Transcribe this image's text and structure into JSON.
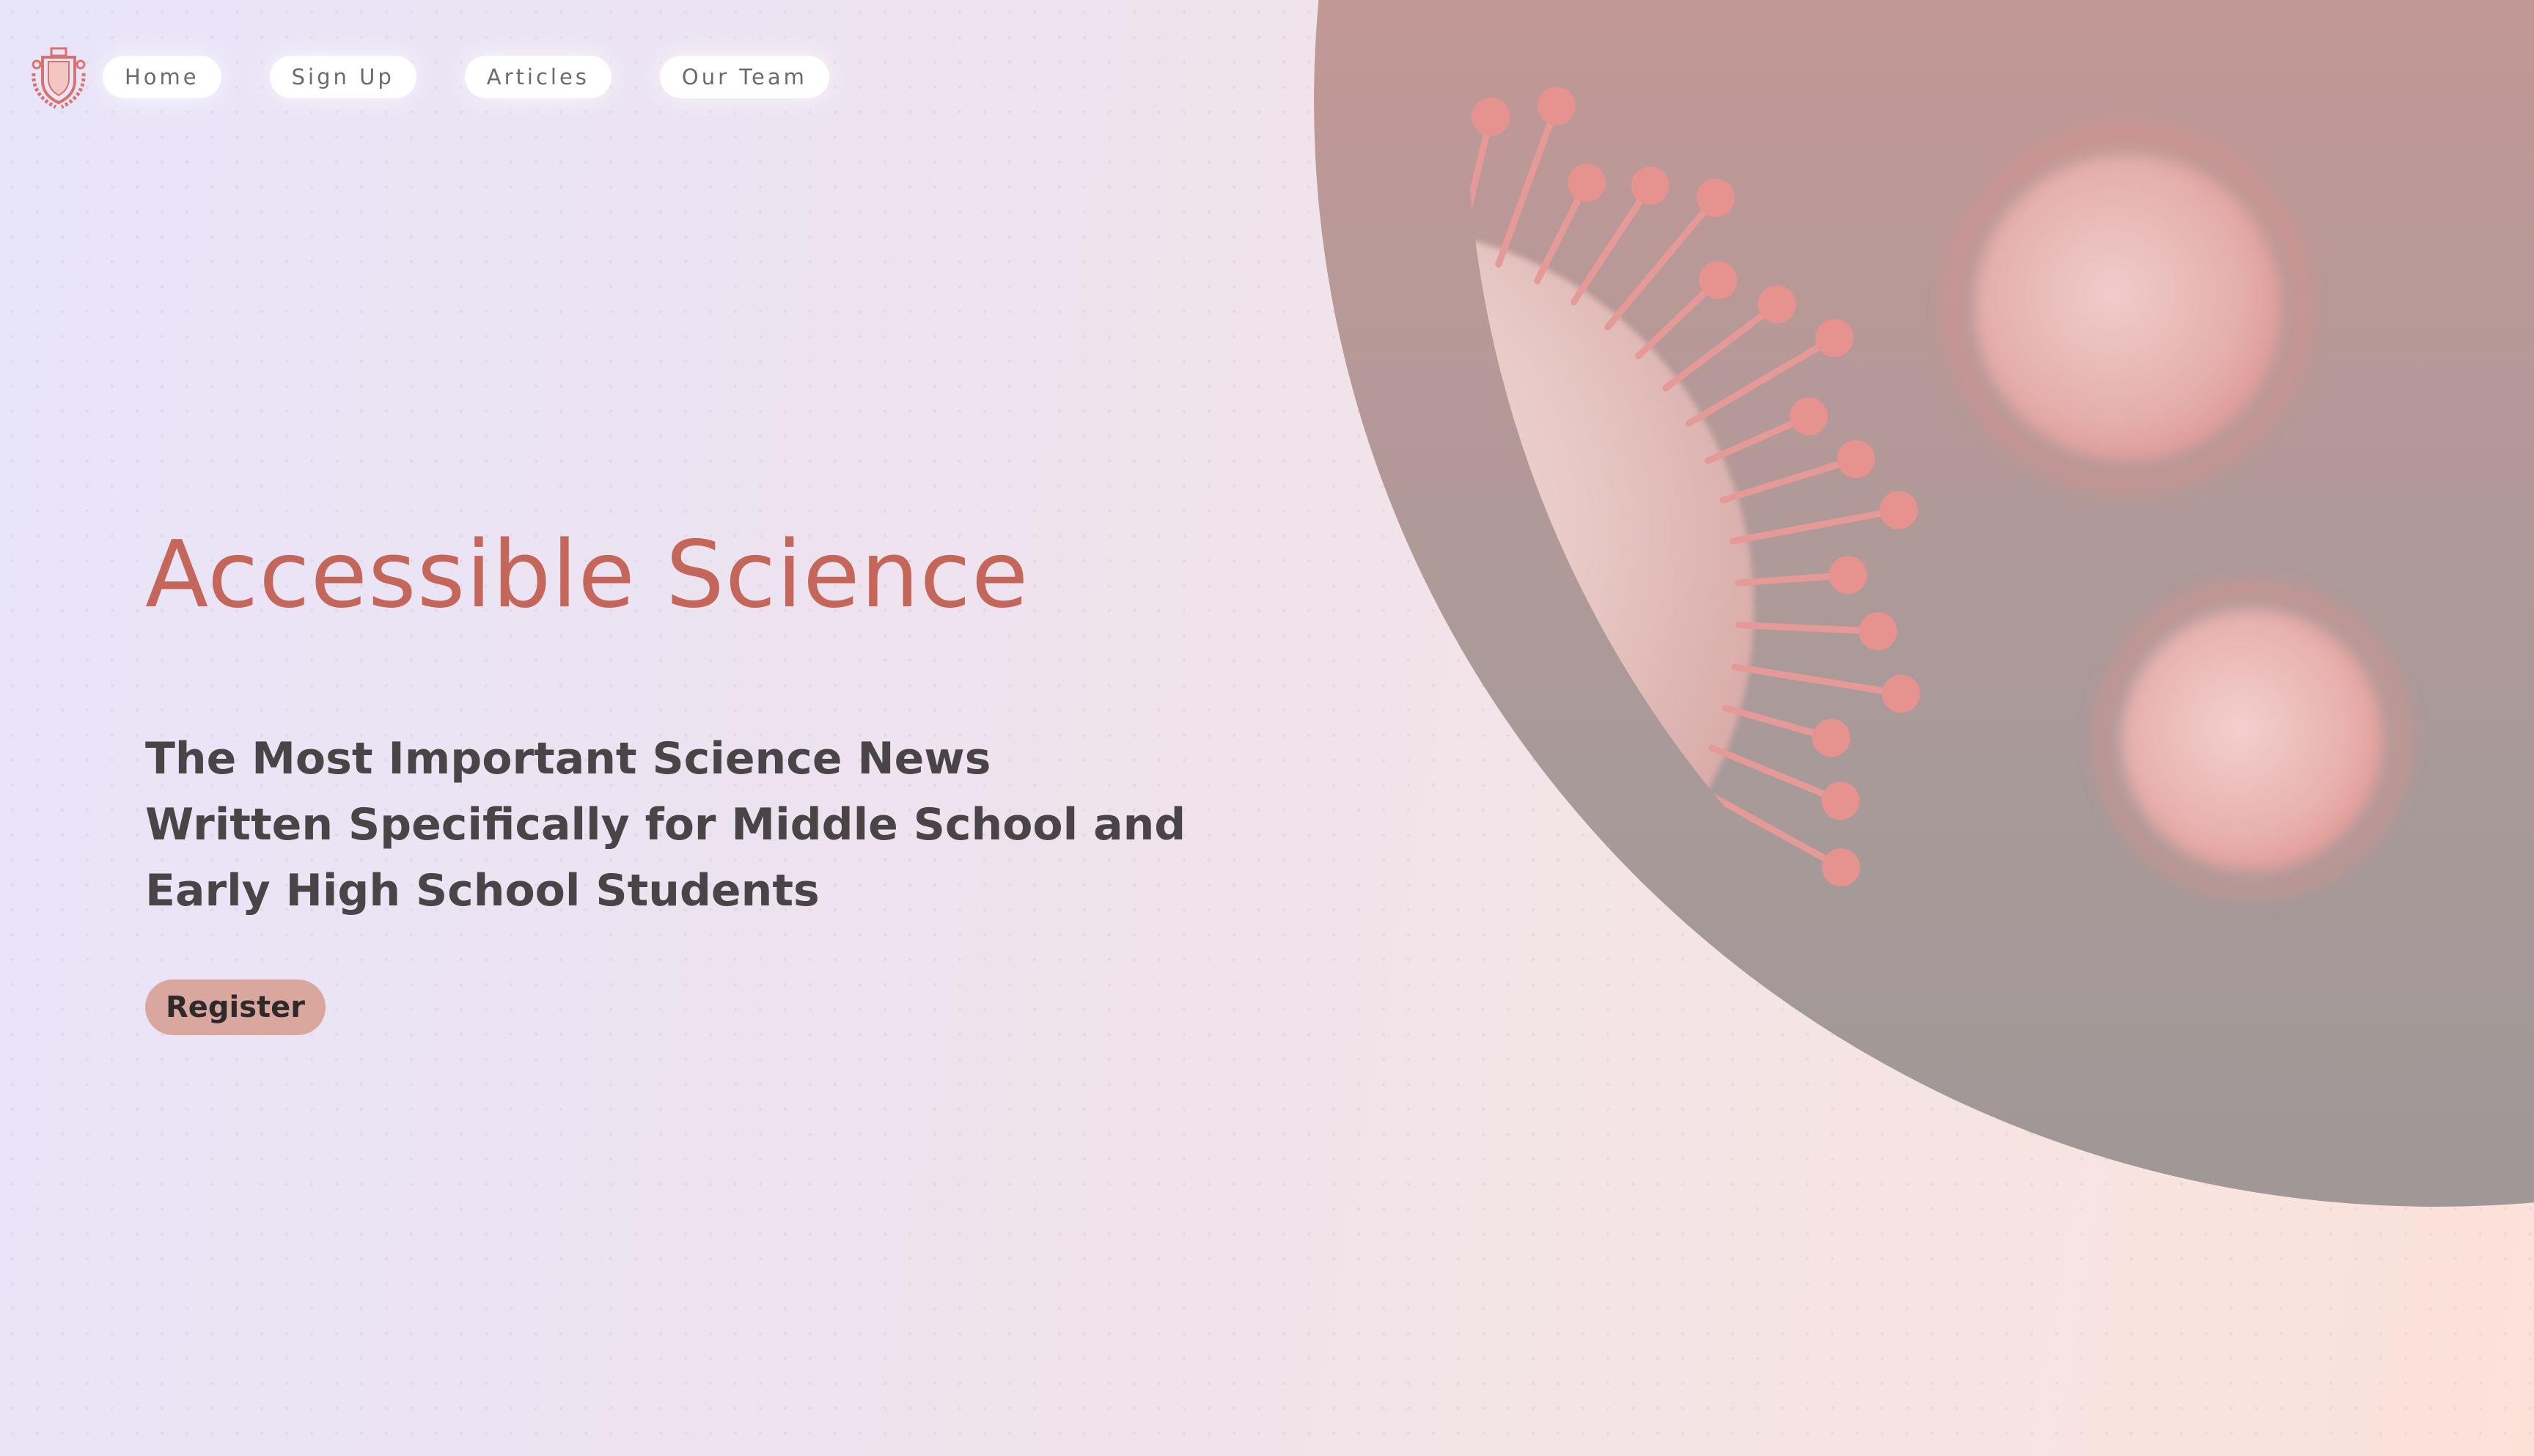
{
  "nav": {
    "items": [
      {
        "label": "Home"
      },
      {
        "label": "Sign Up"
      },
      {
        "label": "Articles"
      },
      {
        "label": "Our Team"
      }
    ]
  },
  "hero": {
    "title": "Accessible Science",
    "subtitle": "The Most Important Science News Written Specifically for Middle School and Early High School Students",
    "cta_label": "Register",
    "image_icon": "virus-illustration"
  },
  "colors": {
    "title": "#c4675a",
    "button": "#d9a79e",
    "text": "#4a4447",
    "logo": "#d9726a"
  }
}
